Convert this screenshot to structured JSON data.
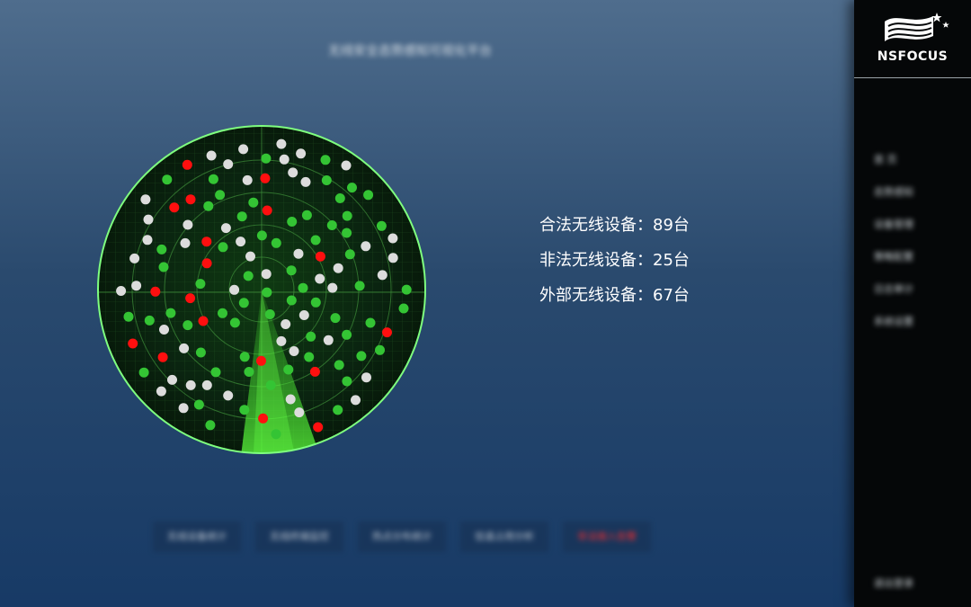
{
  "header": {
    "title": "无线安全态势感知可视化平台"
  },
  "stats": [
    {
      "label": "合法无线设备",
      "sep": "：",
      "value": "89",
      "unit": "台"
    },
    {
      "label": "非法无线设备",
      "sep": "：",
      "value": "25",
      "unit": "台"
    },
    {
      "label": "外部无线设备",
      "sep": "：",
      "value": "67",
      "unit": "台"
    }
  ],
  "radar": {
    "colors": {
      "legal": "#34c434",
      "illegal": "#ff0f0f",
      "external": "#dcdcdc",
      "ring": "#7fff7f",
      "sweep": "#4cff3a"
    }
  },
  "tabs": [
    {
      "label": "无线设备统计"
    },
    {
      "label": "无线终端监控"
    },
    {
      "label": "热点分布统计"
    },
    {
      "label": "信道占用分析"
    },
    {
      "label": "非法接入告警"
    }
  ],
  "sidebar": {
    "brand": "NSFOCUS",
    "items": [
      {
        "label": "首 页"
      },
      {
        "label": "态势感知"
      },
      {
        "label": "设备管理"
      },
      {
        "label": "策略配置"
      },
      {
        "label": "日志审计"
      },
      {
        "label": "系统设置"
      }
    ],
    "footer": "退出登录"
  }
}
